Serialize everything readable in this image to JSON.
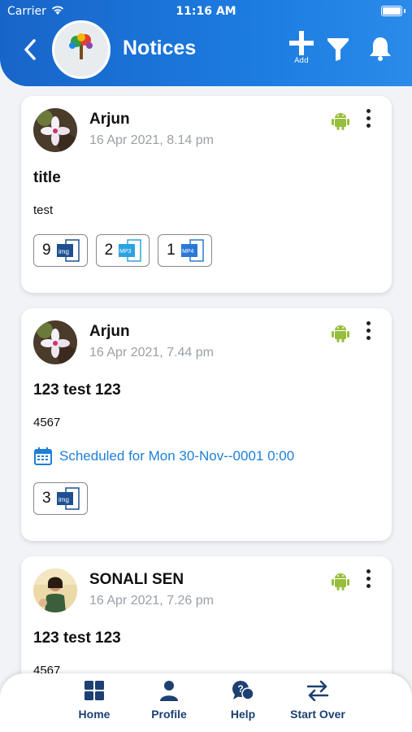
{
  "status_bar": {
    "carrier": "Carrier",
    "time": "11:16 AM"
  },
  "header": {
    "title": "Notices",
    "add_label": "Add",
    "logo_text": "SkoolTree"
  },
  "notices": [
    {
      "author": "Arjun",
      "date": "16 Apr 2021, 8.14 pm",
      "title": "title",
      "body": "test",
      "attachments": [
        {
          "count": "9",
          "type": "img"
        },
        {
          "count": "2",
          "type": "MP3"
        },
        {
          "count": "1",
          "type": "MP4"
        }
      ]
    },
    {
      "author": "Arjun",
      "date": "16 Apr 2021, 7.44 pm",
      "title": "123 test 123",
      "body": "4567",
      "scheduled": "Scheduled for Mon 30-Nov--0001 0:00",
      "attachments": [
        {
          "count": "3",
          "type": "img"
        }
      ]
    },
    {
      "author": "SONALI SEN",
      "date": "16 Apr 2021, 7.26 pm",
      "title": "123 test 123",
      "body": "4567"
    }
  ],
  "bottom_nav": [
    {
      "label": "Home",
      "icon": "grid-icon"
    },
    {
      "label": "Profile",
      "icon": "person-icon"
    },
    {
      "label": "Help",
      "icon": "help-icon"
    },
    {
      "label": "Start Over",
      "icon": "swap-icon"
    }
  ],
  "colors": {
    "header_blue": "#1a6fd6",
    "nav_text": "#1d3f72",
    "scheduled_blue": "#1e7fd8",
    "android_green": "#97bf3d"
  }
}
